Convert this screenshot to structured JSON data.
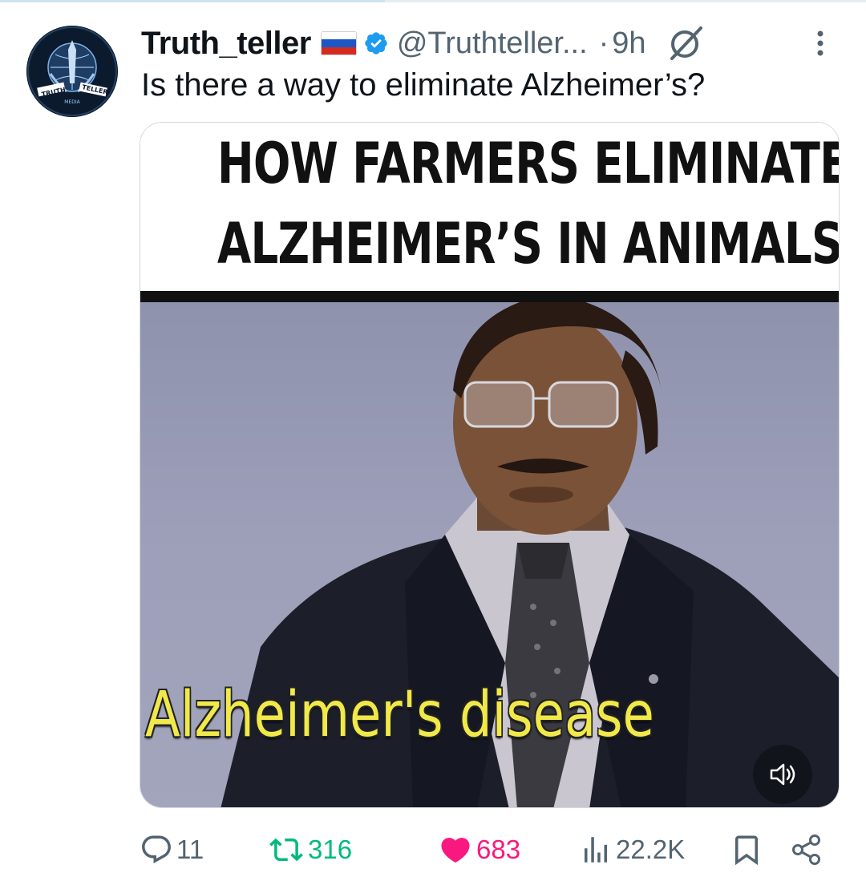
{
  "tweet": {
    "display_name": "Truth_teller",
    "handle": "@Truthteller...",
    "separator": "·",
    "time": "9h",
    "text": "Is there a way to eliminate Alzheimer’s?",
    "flag_icon": "russia-flag-icon",
    "verified_color": "#1d9bf0",
    "avatar": {
      "icon": "truth-teller-logo",
      "logo_text_left": "TRUTH",
      "logo_text_right": "TELLER",
      "logo_text_bottom": "MEDIA"
    }
  },
  "media": {
    "title_line1": "HOW FARMERS ELIMINATED",
    "title_line2": "ALZHEIMER’S IN ANIMALS",
    "subtitle": "Alzheimer's disease",
    "subtitle_color": "#f1e94a",
    "mute_icon": "speaker-muted-icon"
  },
  "actions": {
    "replies": "11",
    "retweets": "316",
    "likes": "683",
    "views": "22.2K",
    "retweet_color": "#00ba7c",
    "like_color": "#f91880"
  }
}
